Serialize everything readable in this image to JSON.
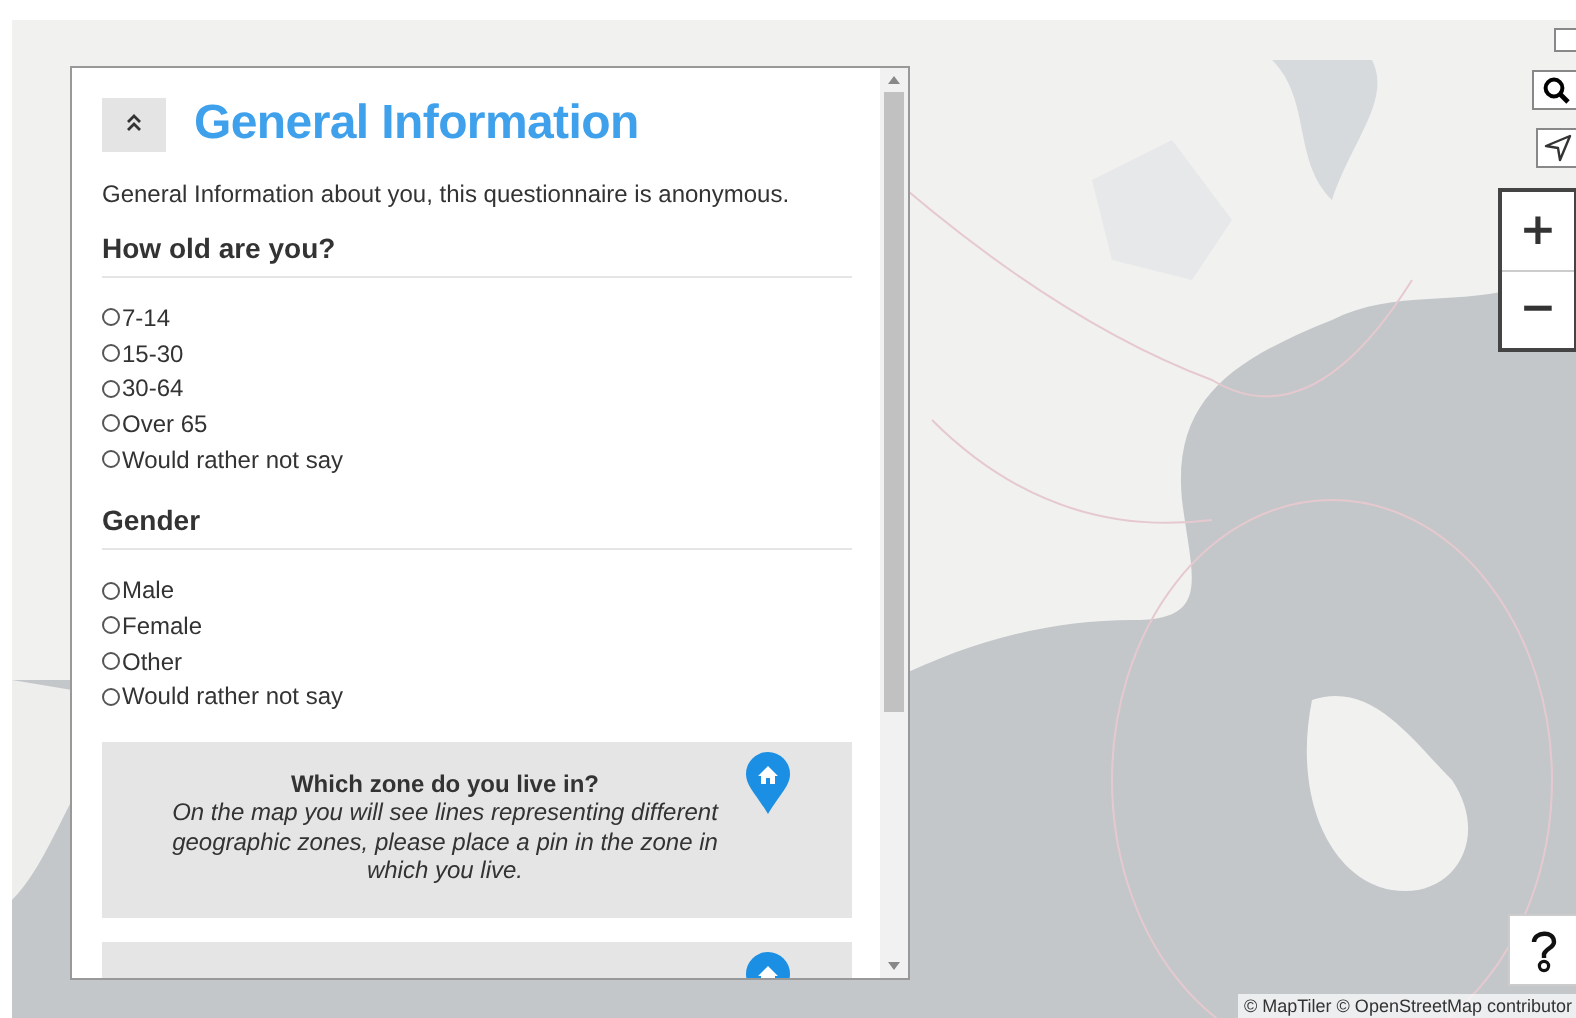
{
  "panel": {
    "title": "General Information",
    "collapsed": false,
    "description": "General Information about you, this questionnaire is anonymous.",
    "questions": [
      {
        "kind": "radio",
        "heading": "How old are you?",
        "options": [
          {
            "label": "7-14",
            "selected": false
          },
          {
            "label": "15-30",
            "selected": false
          },
          {
            "label": "30-64",
            "selected": false
          },
          {
            "label": "Over 65",
            "selected": false
          },
          {
            "label": "Would rather not say",
            "selected": false
          }
        ]
      },
      {
        "kind": "radio",
        "heading": "Gender",
        "options": [
          {
            "label": "Male",
            "selected": false
          },
          {
            "label": "Female",
            "selected": false
          },
          {
            "label": "Other",
            "selected": false
          },
          {
            "label": "Would rather not say",
            "selected": false
          }
        ]
      },
      {
        "kind": "pin",
        "heading": "Which zone do you live in?",
        "text": "On the map you will see lines representing different geographic zones, please place a pin in the zone in which you live."
      },
      {
        "kind": "pin"
      }
    ]
  },
  "map": {
    "zoom_in": "+",
    "zoom_out": "−",
    "attribution": "© MapTiler © OpenStreetMap contributor"
  }
}
